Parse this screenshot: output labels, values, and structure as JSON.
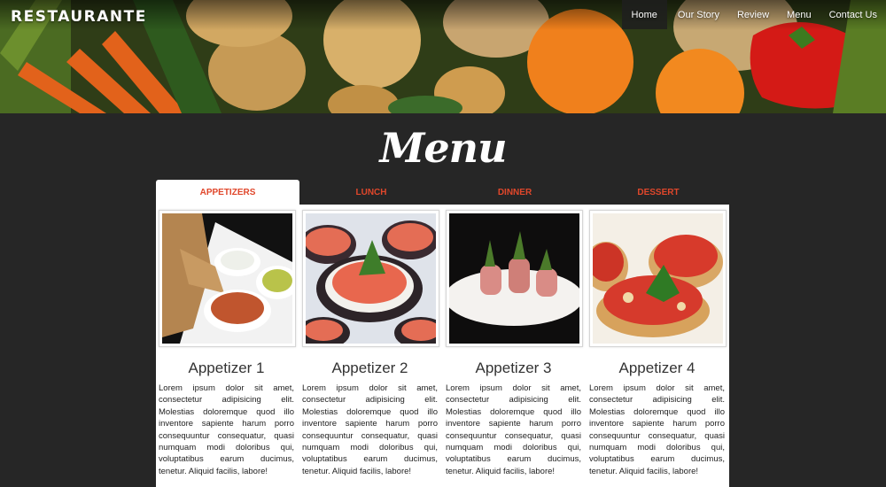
{
  "header": {
    "logo": "RESTAURANTE",
    "nav": [
      "Home",
      "Our Story",
      "Review",
      "Menu",
      "Contact Us"
    ],
    "active_nav": "Home"
  },
  "menu": {
    "title": "Menu",
    "tabs": [
      "APPETIZERS",
      "LUNCH",
      "DINNER",
      "DESSERT"
    ],
    "active_tab": "APPETIZERS",
    "items": [
      {
        "name": "Appetizer 1",
        "desc": "Lorem ipsum dolor sit amet, consectetur adipisicing elit. Molestias doloremque quod illo inventore sapiente harum porro consequuntur consequatur, quasi numquam modi doloribus qui, voluptatibus earum ducimus, tenetur. Aliquid facilis, labore!"
      },
      {
        "name": "Appetizer 2",
        "desc": "Lorem ipsum dolor sit amet, consectetur adipisicing elit. Molestias doloremque quod illo inventore sapiente harum porro consequuntur consequatur, quasi numquam modi doloribus qui, voluptatibus earum ducimus, tenetur. Aliquid facilis, labore!"
      },
      {
        "name": "Appetizer 3",
        "desc": "Lorem ipsum dolor sit amet, consectetur adipisicing elit. Molestias doloremque quod illo inventore sapiente harum porro consequuntur consequatur, quasi numquam modi doloribus qui, voluptatibus earum ducimus, tenetur. Aliquid facilis, labore!"
      },
      {
        "name": "Appetizer 4",
        "desc": "Lorem ipsum dolor sit amet, consectetur adipisicing elit. Molestias doloremque quod illo inventore sapiente harum porro consequuntur consequatur, quasi numquam modi doloribus qui, voluptatibus earum ducimus, tenetur. Aliquid facilis, labore!"
      }
    ]
  },
  "colors": {
    "background": "#262626",
    "tab_accent": "#e0472b",
    "panel": "#ffffff"
  }
}
